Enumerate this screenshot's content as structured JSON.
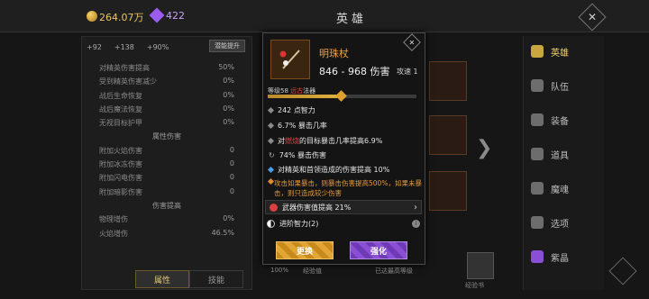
{
  "topbar": {
    "gold": "264.07万",
    "gems": "422",
    "title": "英雄"
  },
  "stats_summary": {
    "attack": "+92",
    "hp": "+138",
    "percent": "+90%",
    "upgrade_label": "潜能提升"
  },
  "stats": [
    {
      "label": "对精英伤害提高",
      "value": "50%"
    },
    {
      "label": "受到精英伤害减少",
      "value": "0%"
    },
    {
      "label": "战后生命恢复",
      "value": "0%"
    },
    {
      "label": "战后魔法恢复",
      "value": "0%"
    },
    {
      "label": "无视目标护甲",
      "value": "0%"
    }
  ],
  "section_attr": "属性伤害",
  "attr_stats": [
    {
      "label": "附加火焰伤害",
      "value": "0"
    },
    {
      "label": "附加冰冻伤害",
      "value": "0"
    },
    {
      "label": "附加闪电伤害",
      "value": "0"
    },
    {
      "label": "附加暗影伤害",
      "value": "0"
    }
  ],
  "section_dmg": "伤害提高",
  "dmg_stats": [
    {
      "label": "物理增伤",
      "value": "0%"
    },
    {
      "label": "火焰增伤",
      "value": "46.5%"
    }
  ],
  "bottom_tabs": {
    "attributes": "属性",
    "skills": "技能"
  },
  "right_nav": [
    {
      "label": "英雄",
      "active": true
    },
    {
      "label": "队伍",
      "active": false
    },
    {
      "label": "装备",
      "active": false
    },
    {
      "label": "道具",
      "active": false
    },
    {
      "label": "魔魂",
      "active": false
    },
    {
      "label": "选项",
      "active": false
    },
    {
      "label": "紫晶",
      "active": false
    }
  ],
  "tooltip": {
    "name": "明珠杖",
    "damage": "846 - 968 伤害",
    "speed": "攻速 1",
    "level_prefix": "等级58 ",
    "level_red": "远古",
    "level_suffix": "法器",
    "affixes": [
      {
        "text": "242 点智力"
      },
      {
        "text": "6.7% 暴击几率"
      },
      {
        "pre": "对",
        "red": "燃烧",
        "post": "的目标暴击几率提高6.9%"
      },
      {
        "text": "74% 暴击伤害"
      },
      {
        "text": "对精英和首领造成的伤害提高 10%"
      }
    ],
    "legendary": "攻击如果暴击，则暴击伤害提高500%，如果未暴击，则只造成较少伤害",
    "gem": "武器伤害值提高 21%",
    "advanced": "进阶智力(2)",
    "replace_label": "更换",
    "enhance_label": "强化"
  },
  "under_labels": {
    "pct": "100%",
    "exp": "经验值",
    "full": "已达最高等级",
    "book": "经验书"
  },
  "colors": {
    "accent": "#e0c879",
    "legendary": "#f0a040",
    "red": "#e04646",
    "blue_bullet": "#4aa0e8"
  }
}
